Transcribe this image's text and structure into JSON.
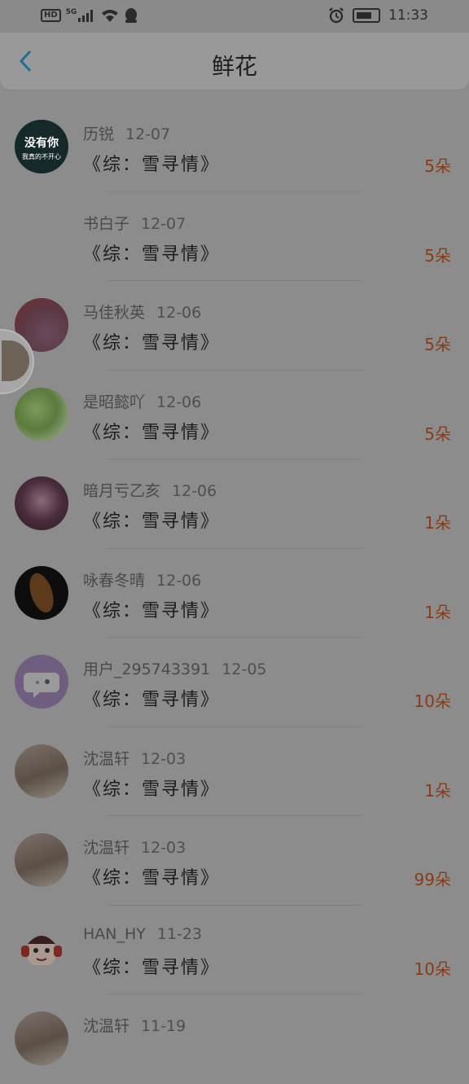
{
  "status_bar": {
    "network": "HD",
    "net_type": "5G",
    "time": "11:33"
  },
  "header": {
    "back_icon": "chevron-left-icon",
    "title": "鲜花"
  },
  "colors": {
    "accent_back": "#1f6f99",
    "count_color": "#8b3b14"
  },
  "entries": [
    {
      "name": "历锐",
      "date": "12-07",
      "book": "《综：雪寻情》",
      "count": "5朵",
      "avatar_text_1": "没有你",
      "avatar_text_2": "我真的不开心"
    },
    {
      "name": "书白子",
      "date": "12-07",
      "book": "《综：雪寻情》",
      "count": "5朵"
    },
    {
      "name": "马佳秋英",
      "date": "12-06",
      "book": "《综：雪寻情》",
      "count": "5朵"
    },
    {
      "name": "是昭懿吖",
      "date": "12-06",
      "book": "《综：雪寻情》",
      "count": "5朵"
    },
    {
      "name": "暗月亏乙亥",
      "date": "12-06",
      "book": "《综：雪寻情》",
      "count": "1朵"
    },
    {
      "name": "咏春冬晴",
      "date": "12-06",
      "book": "《综：雪寻情》",
      "count": "1朵"
    },
    {
      "name": "用户_295743391",
      "date": "12-05",
      "book": "《综：雪寻情》",
      "count": "10朵"
    },
    {
      "name": "沈温轩",
      "date": "12-03",
      "book": "《综：雪寻情》",
      "count": "1朵"
    },
    {
      "name": "沈温轩",
      "date": "12-03",
      "book": "《综：雪寻情》",
      "count": "99朵"
    },
    {
      "name": "HAN_HY",
      "date": "11-23",
      "book": "《综：雪寻情》",
      "count": "10朵"
    },
    {
      "name": "沈温轩",
      "date": "11-19",
      "book": "",
      "count": ""
    }
  ]
}
